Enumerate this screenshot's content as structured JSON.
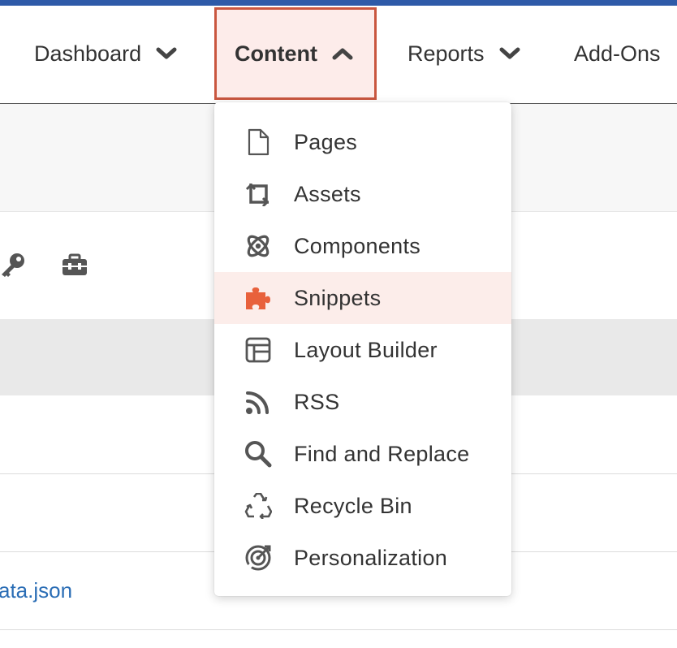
{
  "nav": {
    "items": [
      {
        "label": "Dashboard",
        "chevron": "down"
      },
      {
        "label": "Content",
        "chevron": "up"
      },
      {
        "label": "Reports",
        "chevron": "down"
      },
      {
        "label": "Add-Ons"
      }
    ]
  },
  "menu": {
    "items": [
      {
        "label": "Pages",
        "icon": "page-icon"
      },
      {
        "label": "Assets",
        "icon": "crop-icon"
      },
      {
        "label": "Components",
        "icon": "atom-icon"
      },
      {
        "label": "Snippets",
        "icon": "puzzle-icon"
      },
      {
        "label": "Layout Builder",
        "icon": "layout-icon"
      },
      {
        "label": "RSS",
        "icon": "rss-icon"
      },
      {
        "label": "Find and Replace",
        "icon": "search-icon"
      },
      {
        "label": "Recycle Bin",
        "icon": "recycle-icon"
      },
      {
        "label": "Personalization",
        "icon": "target-icon"
      }
    ]
  },
  "content": {
    "file_link": "ata.json"
  },
  "colors": {
    "accent": "#c9563f",
    "active_bg": "#fdecea",
    "snippet_icon": "#e8613c",
    "topbar": "#2e5aa8",
    "link": "#2a6db5"
  }
}
